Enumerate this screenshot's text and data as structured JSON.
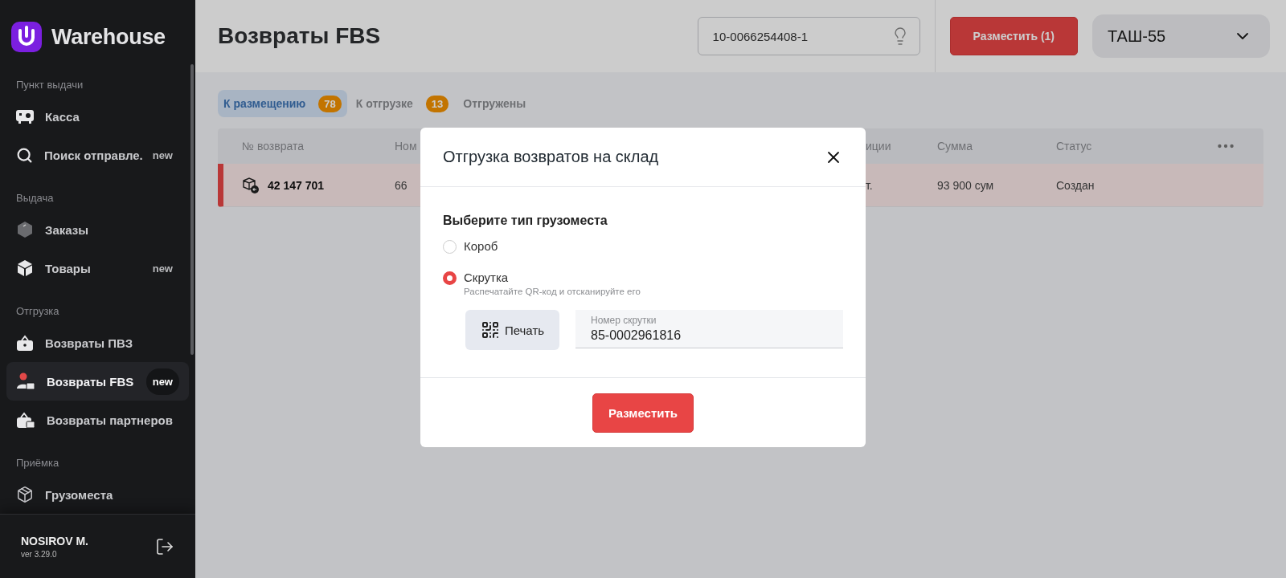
{
  "sidebar": {
    "logo": "Warehouse",
    "sections": [
      {
        "title": "Пункт выдачи",
        "items": [
          {
            "label": "Касса",
            "selected": false
          },
          {
            "label": "Поиск отправле.",
            "badge": "new",
            "selected": false
          }
        ]
      },
      {
        "title": "Выдача",
        "items": [
          {
            "label": "Заказы",
            "selected": false
          },
          {
            "label": "Товары",
            "badge": "new",
            "selected": false
          }
        ]
      },
      {
        "title": "Отгрузка",
        "items": [
          {
            "label": "Возвраты ПВЗ",
            "selected": false
          },
          {
            "label": "Возвраты FBS",
            "badge": "new",
            "selected": true
          },
          {
            "label": "Возвраты партнеров",
            "selected": false
          }
        ]
      },
      {
        "title": "Приёмка",
        "items": [
          {
            "label": "Грузоместа",
            "selected": false
          }
        ]
      }
    ],
    "user": {
      "name": "NOSIROV M.",
      "version": "ver 3.29.0"
    }
  },
  "header": {
    "title": "Возвраты FBS",
    "search": {
      "value": "10-0066254408-1"
    },
    "place_button": "Разместить (1)",
    "branch_select": "ТАШ-55"
  },
  "tabs": [
    {
      "label": "К размещению",
      "count": "78",
      "selected": true
    },
    {
      "label": "К отгрузке",
      "count": "13",
      "selected": false
    },
    {
      "label": "Отгружены",
      "selected": false
    }
  ],
  "table": {
    "columns": [
      "№ возврата",
      "Ном",
      "иции",
      "Сумма",
      "Статус"
    ],
    "rows": [
      {
        "cells": [
          "42 147 701",
          "66",
          "т.",
          "93 900 сум",
          "Создан"
        ],
        "flagged": true
      }
    ]
  },
  "modal": {
    "title": "Отгрузка возвратов на склад",
    "question": "Выберите тип грузоместа",
    "options": [
      {
        "label": "Короб",
        "selected": false
      },
      {
        "label": "Скрутка",
        "hint": "Распечатайте QR-код и отсканируйте его",
        "selected": true
      }
    ],
    "print_button": "Печать",
    "roll_field": {
      "label": "Номер скрутки",
      "value": "85-0002961816"
    },
    "submit": "Разместить"
  }
}
